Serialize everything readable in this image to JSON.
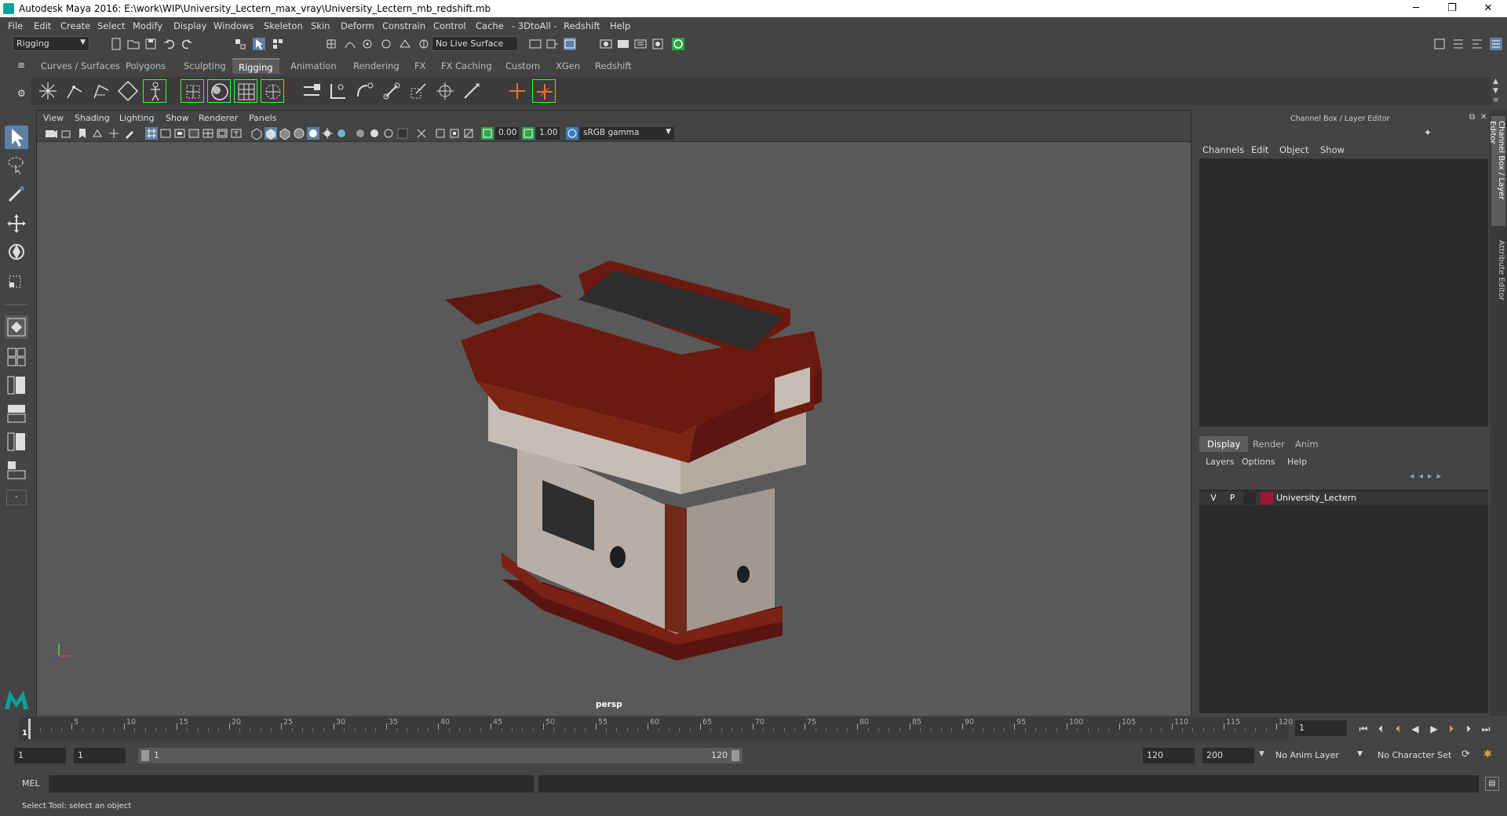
{
  "window": {
    "title": "Autodesk Maya 2016: E:\\work\\WIP\\University_Lectern_max_vray\\University_Lectern_mb_redshift.mb",
    "minimize": "─",
    "restore": "❐",
    "close": "✕"
  },
  "menubar": [
    "File",
    "Edit",
    "Create",
    "Select",
    "Modify",
    "Display",
    "Windows",
    "Skeleton",
    "Skin",
    "Deform",
    "Constrain",
    "Control",
    "Cache",
    "- 3DtoAll -",
    "Redshift",
    "Help"
  ],
  "statusline": {
    "mode": "Rigging",
    "live_surface": "No Live Surface"
  },
  "shelf": {
    "tabs": [
      "Curves / Surfaces",
      "Polygons",
      "Sculpting",
      "Rigging",
      "Animation",
      "Rendering",
      "FX",
      "FX Caching",
      "Custom",
      "XGen",
      "Redshift"
    ],
    "active_tab": "Rigging"
  },
  "viewport": {
    "menu": [
      "View",
      "Shading",
      "Lighting",
      "Show",
      "Renderer",
      "Panels"
    ],
    "exposure": "0.00",
    "gamma": "1.00",
    "color_space": "sRGB gamma",
    "camera_label": "persp"
  },
  "channel_box": {
    "title": "Channel Box / Layer Editor",
    "menu": [
      "Channels",
      "Edit",
      "Object",
      "Show"
    ]
  },
  "layer_editor": {
    "tabs": [
      "Display",
      "Render",
      "Anim"
    ],
    "active_tab": "Display",
    "menu": [
      "Layers",
      "Options",
      "Help"
    ],
    "layers": [
      {
        "visible": "V",
        "playback": "P",
        "name": "University_Lectern",
        "color": "#a0143c"
      }
    ]
  },
  "side_tabs": [
    "Channel Box / Layer Editor",
    "Attribute Editor"
  ],
  "timeline": {
    "ticks": [
      "5",
      "10",
      "15",
      "20",
      "25",
      "30",
      "35",
      "40",
      "45",
      "50",
      "55",
      "60",
      "65",
      "70",
      "75",
      "80",
      "85",
      "90",
      "95",
      "100",
      "105",
      "110",
      "115",
      "120"
    ],
    "start_label": "1",
    "current_frame": "1"
  },
  "range": {
    "start_time": "1",
    "playback_start": "1",
    "range_start_label": "1",
    "range_end_label": "120",
    "playback_end": "120",
    "end_time": "200",
    "anim_layer": "No Anim Layer",
    "character_set": "No Character Set"
  },
  "command_line": {
    "label": "MEL",
    "help_text": "Select Tool: select an object"
  },
  "colors": {
    "wood": "#6b1a10",
    "panel": "#b0a8a0",
    "screen": "#2e2e2e",
    "accent": "#5d81a6"
  }
}
